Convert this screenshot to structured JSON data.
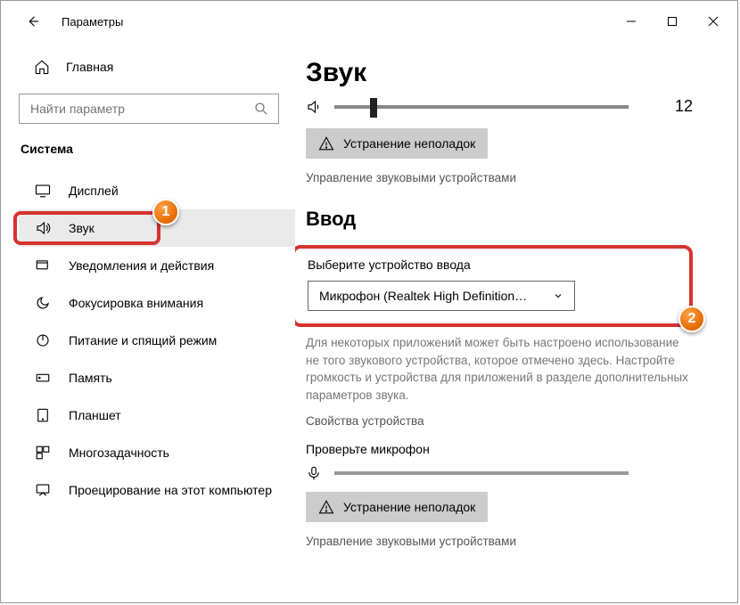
{
  "titlebar": {
    "title": "Параметры"
  },
  "sidebar": {
    "home_label": "Главная",
    "search_placeholder": "Найти параметр",
    "heading": "Система",
    "items": [
      {
        "label": "Дисплей"
      },
      {
        "label": "Звук"
      },
      {
        "label": "Уведомления и действия"
      },
      {
        "label": "Фокусировка внимания"
      },
      {
        "label": "Питание и спящий режим"
      },
      {
        "label": "Память"
      },
      {
        "label": "Планшет"
      },
      {
        "label": "Многозадачность"
      },
      {
        "label": "Проецирование на этот компьютер"
      }
    ]
  },
  "main": {
    "title": "Звук",
    "volume_value": "12",
    "troubleshoot1_label": "Устранение неполадок",
    "manage_devices": "Управление звуковыми устройствами",
    "input_heading": "Ввод",
    "input_device_label": "Выберите устройство ввода",
    "input_device_selected": "Микрофон (Realtek High Definition…",
    "helper_text": "Для некоторых приложений может быть настроено использование не того звукового устройства, которое отмечено здесь. Настройте громкость и устройства для приложений в разделе дополнительных параметров звука.",
    "device_properties": "Свойства устройства",
    "test_mic_label": "Проверьте микрофон",
    "troubleshoot2_label": "Устранение неполадок",
    "manage_devices2": "Управление звуковыми устройствами"
  },
  "markers": {
    "one": "1",
    "two": "2"
  }
}
